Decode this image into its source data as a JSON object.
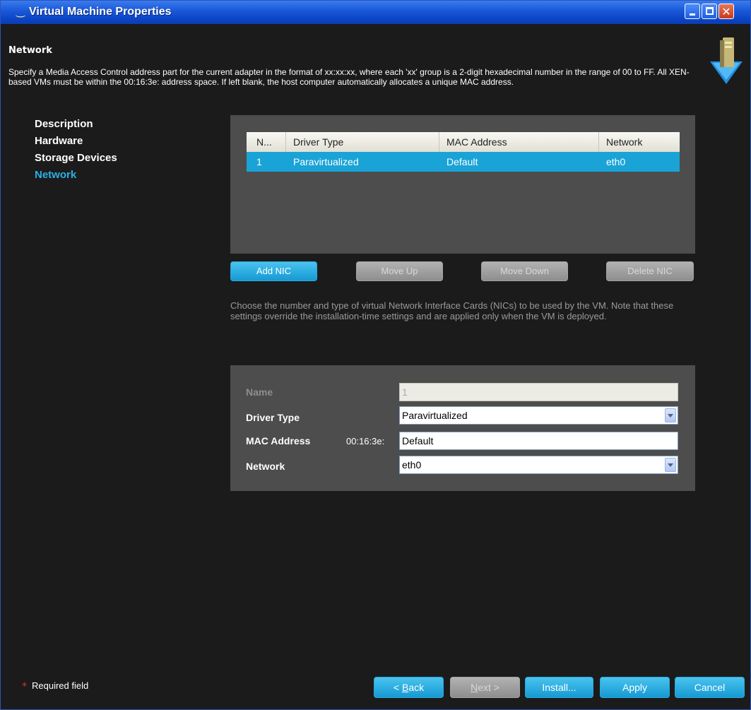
{
  "window": {
    "title": "Virtual Machine Properties"
  },
  "header": {
    "title": "Network",
    "description": "Specify a Media Access Control address part for the current adapter in the format of xx:xx:xx, where each 'xx' group is a 2-digit hexadecimal number in the range of 00 to FF. All XEN-based VMs must be within the 00:16:3e: address space. If left blank, the host computer automatically allocates a unique MAC address."
  },
  "nav": {
    "items": [
      {
        "label": "Description",
        "active": false
      },
      {
        "label": "Hardware",
        "active": false
      },
      {
        "label": "Storage Devices",
        "active": false
      },
      {
        "label": "Network",
        "active": true
      }
    ]
  },
  "nic_table": {
    "columns": [
      "N...",
      "Driver Type",
      "MAC Address",
      "Network"
    ],
    "rows": [
      {
        "n": "1",
        "driver_type": "Paravirtualized",
        "mac_address": "Default",
        "network": "eth0",
        "selected": true
      }
    ]
  },
  "nic_buttons": {
    "add": "Add NIC",
    "move_up": "Move Up",
    "move_down": "Move Down",
    "delete": "Delete NIC"
  },
  "nic_help": "Choose the number and type of virtual Network Interface Cards (NICs) to be used by the VM. Note that these settings override the installation-time settings and are applied only when the VM is deployed.",
  "form": {
    "name_label": "Name",
    "name_value": "1",
    "driver_type_label": "Driver Type",
    "driver_type_value": "Paravirtualized",
    "mac_label": "MAC Address",
    "mac_prefix": "00:16:3e:",
    "mac_value": "Default",
    "network_label": "Network",
    "network_value": "eth0"
  },
  "footer": {
    "required_star": "*",
    "required_text": "Required field",
    "back_prefix": "< ",
    "back_mnemonic": "B",
    "back_rest": "ack",
    "next_mnemonic": "N",
    "next_rest": "ext >",
    "install": "Install...",
    "apply": "Apply",
    "cancel": "Cancel"
  },
  "colors": {
    "accent": "#1aa3d6",
    "titlebar": "#1b5ad9",
    "panel": "#4d4d4d",
    "background": "#1b1b1b"
  }
}
